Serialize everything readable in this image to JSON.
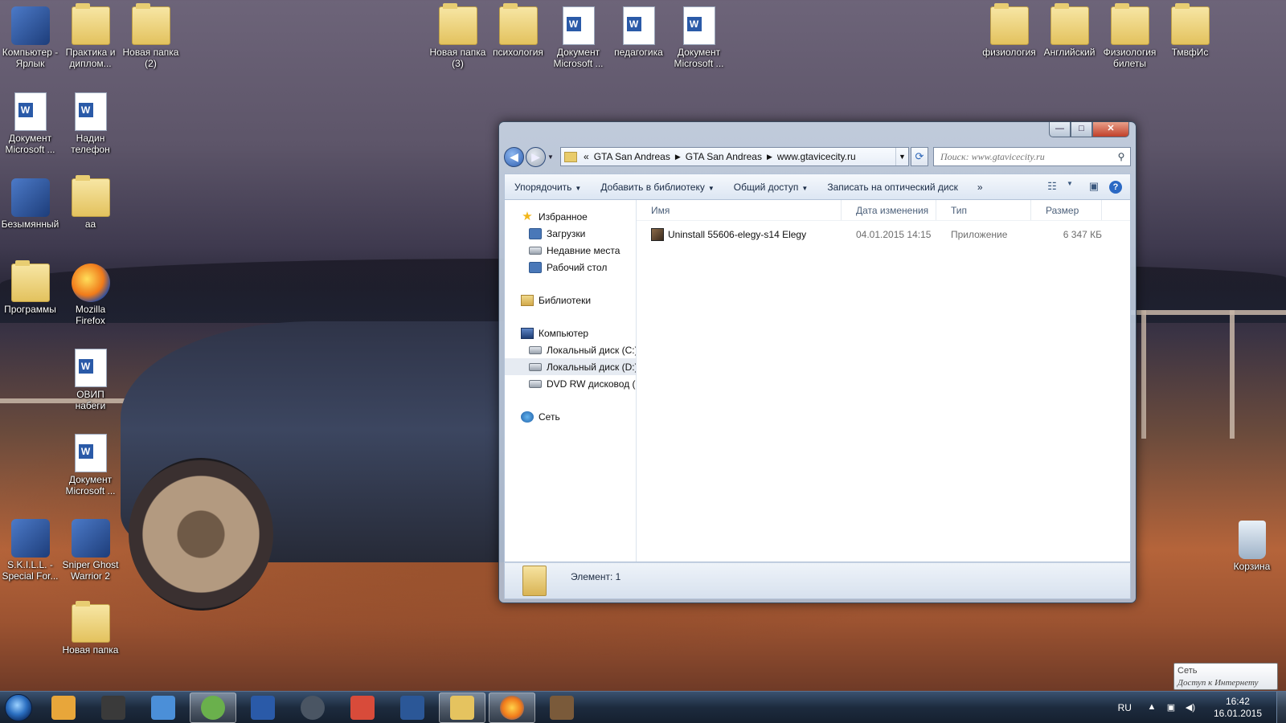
{
  "desktop": {
    "icons": [
      {
        "label": "Компьютер - Ярлык",
        "icon": "computer-icon"
      },
      {
        "label": "Практика и диплом...",
        "icon": "folder-icon"
      },
      {
        "label": "Новая папка (2)",
        "icon": "folder-icon"
      },
      {
        "label": "Новая папка (3)",
        "icon": "folder-icon"
      },
      {
        "label": "психология",
        "icon": "folder-icon"
      },
      {
        "label": "Документ Microsoft ...",
        "icon": "word-document-icon"
      },
      {
        "label": "педагогика",
        "icon": "word-document-icon"
      },
      {
        "label": "Документ Microsoft ...",
        "icon": "word-document-icon"
      },
      {
        "label": "физиология",
        "icon": "folder-icon"
      },
      {
        "label": "Английский",
        "icon": "folder-icon"
      },
      {
        "label": "Физиология билеты",
        "icon": "folder-icon"
      },
      {
        "label": "ТмвфИс",
        "icon": "folder-icon"
      },
      {
        "label": "Документ Microsoft ...",
        "icon": "word-document-icon"
      },
      {
        "label": "Надин телефон",
        "icon": "word-document-icon"
      },
      {
        "label": "Безымянный",
        "icon": "image-file-icon"
      },
      {
        "label": "аа",
        "icon": "folder-icon"
      },
      {
        "label": "Программы",
        "icon": "folder-icon"
      },
      {
        "label": "Mozilla Firefox",
        "icon": "firefox-icon"
      },
      {
        "label": "ОВИП набеги",
        "icon": "winrar-archive-icon"
      },
      {
        "label": "Документ Microsoft ...",
        "icon": "word-document-icon"
      },
      {
        "label": "S.K.I.L.L. - Special For...",
        "icon": "game-icon"
      },
      {
        "label": "Sniper Ghost Warrior 2",
        "icon": "game-icon"
      },
      {
        "label": "Новая папка",
        "icon": "folder-icon"
      },
      {
        "label": "Корзина",
        "icon": "recycle-bin-icon"
      }
    ]
  },
  "window": {
    "caption": {
      "minimize": "—",
      "maximize": "□",
      "close": "✕"
    },
    "address": {
      "overflow": "«",
      "crumbs": [
        "GTA San Andreas",
        "GTA San Andreas",
        "www.gtavicecity.ru"
      ]
    },
    "search": {
      "placeholder": "Поиск: www.gtavicecity.ru"
    },
    "toolbar": {
      "organize": "Упорядочить",
      "add_to_library": "Добавить в библиотеку",
      "share": "Общий доступ",
      "burn": "Записать на оптический диск",
      "more": "»"
    },
    "navpane": {
      "favorites": "Избранное",
      "downloads": "Загрузки",
      "recent": "Недавние места",
      "desktop": "Рабочий стол",
      "libraries": "Библиотеки",
      "computer": "Компьютер",
      "drive_c": "Локальный диск (C:)",
      "drive_d": "Локальный диск (D:)",
      "dvd": "DVD RW дисковод (E:",
      "network": "Сеть"
    },
    "columns": {
      "name": "Имя",
      "modified": "Дата изменения",
      "type": "Тип",
      "size": "Размер"
    },
    "files": [
      {
        "name": "Uninstall 55606-elegy-s14 Elegy",
        "modified": "04.01.2015 14:15",
        "type": "Приложение",
        "size": "6 347 КБ"
      }
    ],
    "details": {
      "count": "Элемент: 1"
    }
  },
  "tooltip": {
    "title": "Сеть",
    "body": "Доступ к Интернету"
  },
  "taskbar": {
    "pinned": [
      {
        "name": "media-player",
        "color": "#e8a63a"
      },
      {
        "name": "game-character",
        "color": "#3a3a3a"
      },
      {
        "name": "volume-app",
        "color": "#4b8fd8"
      },
      {
        "name": "utorrent",
        "color": "#6ab04c"
      },
      {
        "name": "word-2003",
        "color": "#2a5aa8"
      },
      {
        "name": "steam",
        "color": "#4a5563"
      },
      {
        "name": "rubiks-cube",
        "color": "#d84b3a"
      },
      {
        "name": "word",
        "color": "#2b5797"
      },
      {
        "name": "explorer",
        "color": "#e5c35f"
      },
      {
        "name": "firefox",
        "color": "#f07a1a"
      },
      {
        "name": "game-face",
        "color": "#7a5a3a"
      }
    ],
    "lang": "RU",
    "time": "16:42",
    "date": "16.01.2015"
  }
}
